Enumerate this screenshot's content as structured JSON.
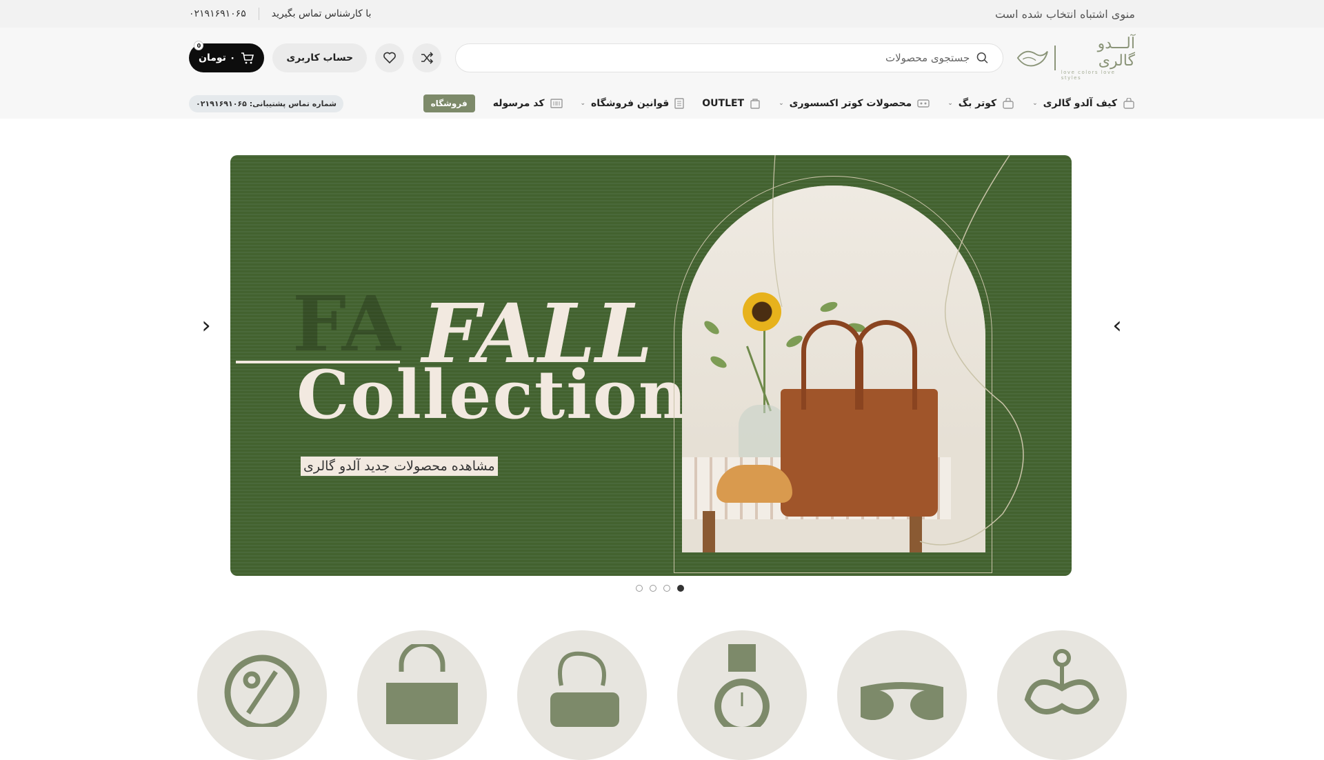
{
  "topbar": {
    "menu_notice": "منوی اشتباه انتخاب شده است",
    "contact_text": "با کارشناس تماس بگیرید",
    "phone": "۰۲۱۹۱۶۹۱۰۶۵"
  },
  "header": {
    "logo_name": "آلـــدو گالری",
    "logo_tagline": "love colors love styles",
    "search_placeholder": "جستجوی محصولات",
    "account_label": "حساب کاربری",
    "cart_label": "۰ تومان",
    "cart_count": "0"
  },
  "nav": {
    "items": [
      {
        "label": "کیف آلدو گالری",
        "icon": "bag-icon",
        "has_dropdown": true
      },
      {
        "label": "کوتر بگ",
        "icon": "bag-icon",
        "has_dropdown": true
      },
      {
        "label": "محصولات کوتر اکسسوری",
        "icon": "accessory-icon",
        "has_dropdown": true
      },
      {
        "label": "OUTLET",
        "icon": "outlet-icon",
        "has_dropdown": false
      },
      {
        "label": "قوانین فروشگاه",
        "icon": "document-icon",
        "has_dropdown": true
      },
      {
        "label": "کد مرسوله",
        "icon": "barcode-icon",
        "has_dropdown": false
      }
    ],
    "shop_badge": "فروشگاه",
    "support_label": "شماره تماس پشتیبانی: ۰۲۱۹۱۶۹۱۰۶۵"
  },
  "hero": {
    "title_line1": "FALL",
    "title_line2": "Collection",
    "cta": "مشاهده محصولات جدید آلدو گالری",
    "slide_count": 4,
    "active_slide": 1
  },
  "colors": {
    "accent": "#7d8a6a",
    "hero_bg": "#43622f",
    "cart_bg": "#0d0d0d"
  },
  "categories": [
    {
      "icon": "discount-icon"
    },
    {
      "icon": "shopping-bag-icon"
    },
    {
      "icon": "crossbody-bag-icon"
    },
    {
      "icon": "watch-icon"
    },
    {
      "icon": "sunglasses-icon"
    },
    {
      "icon": "keychain-icon"
    }
  ]
}
